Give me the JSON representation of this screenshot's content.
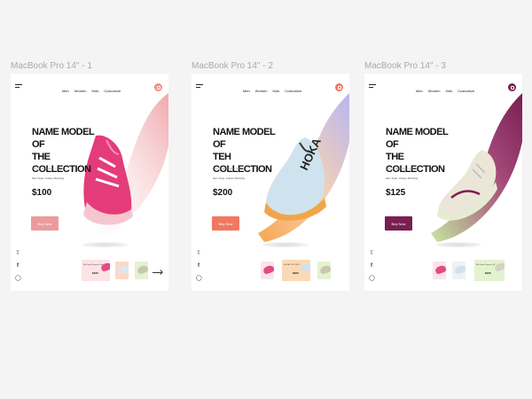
{
  "frames": [
    {
      "label": "MacBook Pro 14\" - 1",
      "nav": [
        "Men",
        "Women",
        "Kids",
        "Customize"
      ],
      "title_line1": "NAME MODEL OF",
      "title_line2": "THE COLLECTION",
      "subtitle": "Item no description info",
      "type": "Item Type: Unisex Running",
      "price": "$100",
      "button": "Buy Now",
      "accent": "#ec9a9a",
      "thumb_title": "Nb Zoom Pegasus Max",
      "thumb_price": "$100"
    },
    {
      "label": "MacBook Pro 14\" - 2",
      "nav": [
        "Men",
        "Women",
        "Kids",
        "Customize"
      ],
      "title_line1": "NAME MODEL OF",
      "title_line2": "TEH COLLECTION",
      "subtitle": "Item no description info",
      "type": "Item Type: Unisex Running",
      "price": "$200",
      "button": "Buy Now",
      "accent": "#f07860",
      "thumb_title": "HOKA CLIFTON 8",
      "thumb_price": "$200"
    },
    {
      "label": "MacBook Pro 14\" - 3",
      "nav": [
        "Men",
        "Women",
        "Kids",
        "Customize"
      ],
      "title_line1": "NAME MODEL OF",
      "title_line2": "THE COLLECTION",
      "subtitle": "Item no description info",
      "type": "Item Type: Unisex Running",
      "price": "$125",
      "button": "Buy Now",
      "accent": "#7a1e52",
      "thumb_title": "Nb Zoom Pegasus 38",
      "thumb_price": "$125"
    }
  ],
  "icons": [
    "hamburger-menu-icon",
    "cart-icon",
    "twitter-icon",
    "facebook-icon",
    "instagram-icon",
    "arrow-right-icon"
  ]
}
